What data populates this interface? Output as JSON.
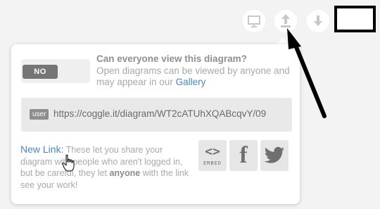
{
  "toolbar": {
    "present_icon": "presentation-icon",
    "share_icon": "share-upload-icon",
    "download_icon": "download-icon",
    "icon_color": "#c8c8c8"
  },
  "popup": {
    "toggle_label": "NO",
    "visibility_question": "Can everyone view this diagram?",
    "visibility_desc_1": "Open diagrams can be viewed by anyone and may appear in our ",
    "gallery_link": "Gallery",
    "user_badge": "user",
    "diagram_url": "https://coggle.it/diagram/WT2cATUhXQABcqvY/09",
    "new_link_label": "New Link:",
    "new_link_desc_1": "These let you share your diagram with people who aren't logged in, but be careful, they let ",
    "new_link_emphasis": "anyone",
    "new_link_desc_2": " with the link see your work!",
    "embed_glyph": "<>",
    "embed_label": "EMBED",
    "facebook_glyph": "f",
    "twitter_icon": "twitter-icon"
  },
  "colors": {
    "link": "#4a86c5",
    "muted_text": "#a9a9a9",
    "annotation": "#000000"
  }
}
